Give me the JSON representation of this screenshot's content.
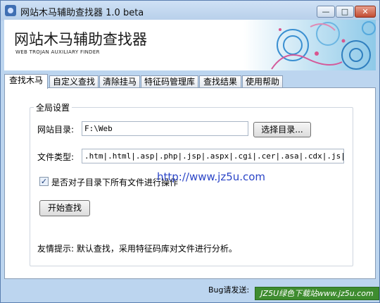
{
  "window": {
    "title": "网站木马辅助查找器 1.0 beta",
    "controls": {
      "minimize": "—",
      "maximize": "□",
      "close": "✕"
    }
  },
  "banner": {
    "title": "网站木马辅助查找器",
    "subtitle": "WEB TROJAN AUXILIARY FINDER"
  },
  "tabs": [
    {
      "label": "查找木马"
    },
    {
      "label": "自定义查找"
    },
    {
      "label": "清除挂马"
    },
    {
      "label": "特征码管理库"
    },
    {
      "label": "查找结果"
    },
    {
      "label": "使用帮助"
    }
  ],
  "global_settings": {
    "legend": "全局设置",
    "site_dir_label": "网站目录:",
    "site_dir_value": "F:\\Web",
    "browse_button": "选择目录...",
    "file_type_label": "文件类型:",
    "file_type_value": ".htm|.html|.asp|.php|.jsp|.aspx|.cgi|.cer|.asa|.cdx|.js|.css",
    "subdir_checkbox_label": "是否对子目录下所有文件进行操作",
    "subdir_checked": true,
    "start_button": "开始查找",
    "tip": "友情提示: 默认查找，采用特征码库对文件进行分析。"
  },
  "watermark": {
    "url_text": "http://www.jz5u.com"
  },
  "statusbar": {
    "text": "Bug请发送:",
    "watermark_text": "JZ5U绿色下载站www.jz5u.com"
  }
}
